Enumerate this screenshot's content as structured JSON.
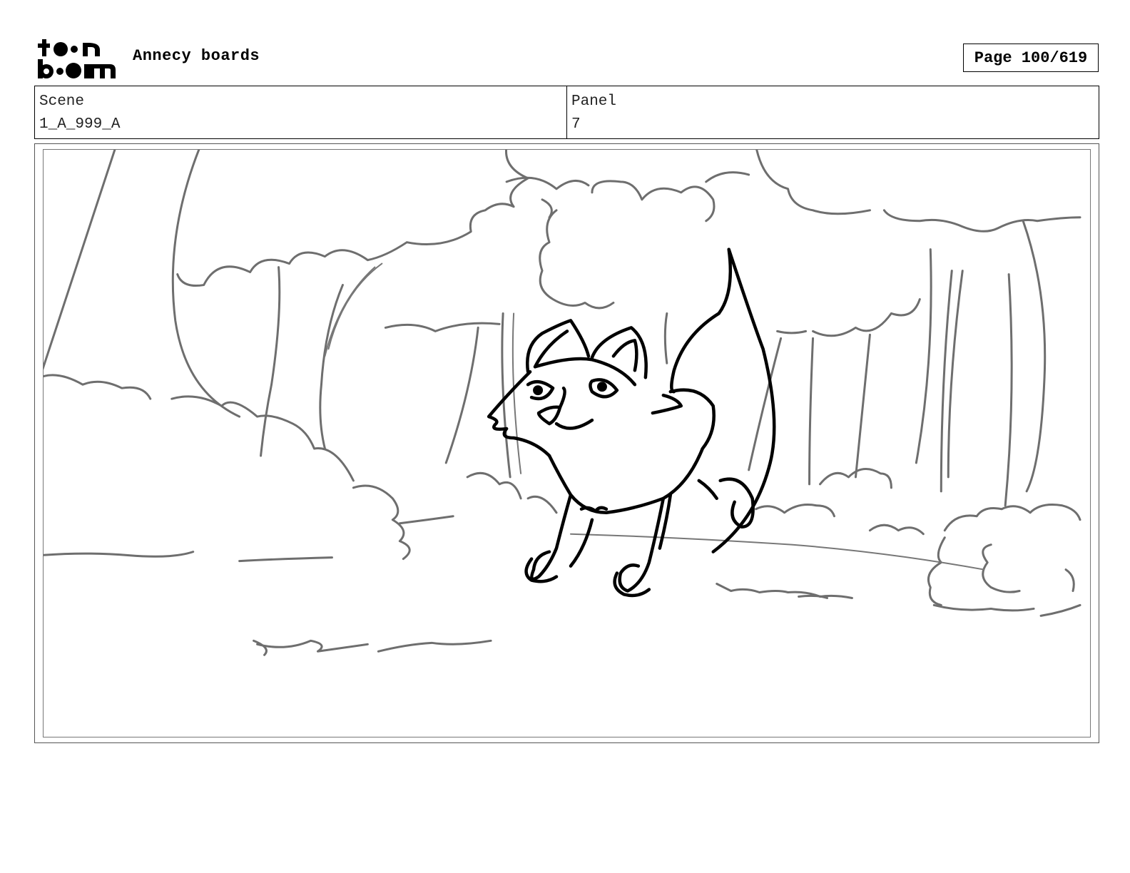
{
  "header": {
    "logo_top": "toon",
    "logo_bottom": "boom",
    "title": "Annecy boards",
    "page_label": "Page 100/619"
  },
  "fields": {
    "scene_label": "Scene",
    "scene_value": "1_A_999_A",
    "panel_label": "Panel",
    "panel_value": "7"
  },
  "panel_image": {
    "icon": "storyboard-sketch-fox-in-forest"
  }
}
